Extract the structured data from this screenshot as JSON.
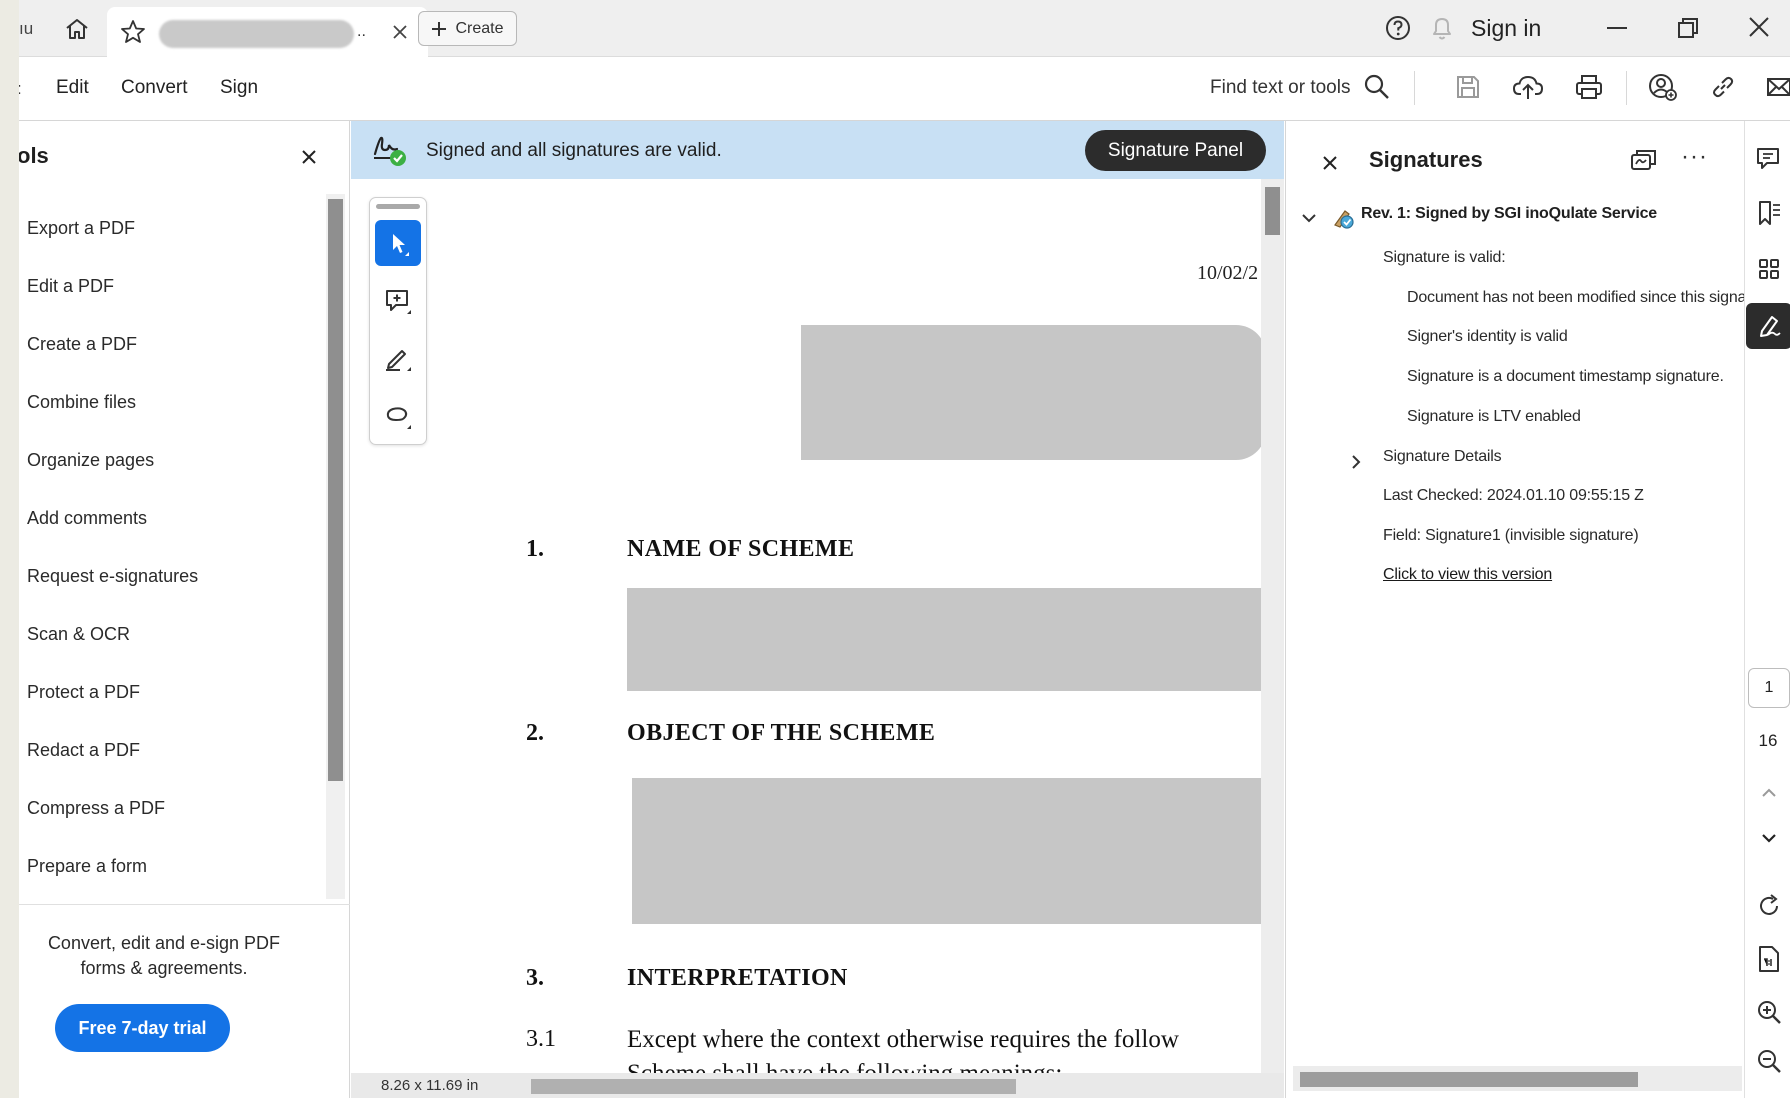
{
  "titlebar": {
    "prev_tab_label": "ıu",
    "tab_title": "████████████",
    "tab_ellipsis": "..",
    "create_label": "Create",
    "sign_in_label": "Sign in"
  },
  "menubar": {
    "cut_item": ":",
    "items": [
      {
        "label": "Edit"
      },
      {
        "label": "Convert"
      },
      {
        "label": "Sign"
      }
    ],
    "find_label": "Find text or tools"
  },
  "tools_panel": {
    "title": "ols",
    "items": [
      {
        "label": "Export a PDF"
      },
      {
        "label": "Edit a PDF"
      },
      {
        "label": "Create a PDF"
      },
      {
        "label": "Combine files"
      },
      {
        "label": "Organize pages"
      },
      {
        "label": "Add comments"
      },
      {
        "label": "Request e-signatures"
      },
      {
        "label": "Scan & OCR"
      },
      {
        "label": "Protect a PDF"
      },
      {
        "label": "Redact a PDF"
      },
      {
        "label": "Compress a PDF"
      },
      {
        "label": "Prepare a form"
      }
    ],
    "promo_line1": "Convert, edit and e-sign PDF",
    "promo_line2": "forms & agreements.",
    "trial_label": "Free 7-day trial"
  },
  "doc": {
    "banner_text": "Signed and all signatures are valid.",
    "signature_panel_label": "Signature Panel",
    "date_text": "10/02/2",
    "sections": [
      {
        "num": "1.",
        "title": "NAME OF SCHEME"
      },
      {
        "num": "2.",
        "title": "OBJECT OF THE SCHEME"
      },
      {
        "num": "3.",
        "title": "INTERPRETATION"
      }
    ],
    "subsection_num": "3.1",
    "subsection_text": "Except where the context otherwise requires the follow",
    "subsection_text2": "Scheme shall have the following meanings:",
    "page_size": "8.26 x 11.69 in"
  },
  "signatures": {
    "title": "Signatures",
    "more": "···",
    "revision_label": "Rev. 1: Signed by SGI inoQulate Service",
    "valid_heading": "Signature is valid:",
    "valid_items": [
      "Document has not been modified since this signature was applied",
      "Signer's identity is valid",
      "Signature is a document timestamp signature.",
      "Signature is LTV enabled"
    ],
    "details_label": "Signature Details",
    "last_checked": "Last Checked: 2024.01.10 09:55:15 Z",
    "field": "Field: Signature1 (invisible signature)",
    "view_version": "Click to view this version"
  },
  "rail": {
    "current_page": "1",
    "total_pages": "16"
  },
  "colors": {
    "accent": "#1473e6",
    "banner": "#c8e0f4",
    "dark_button": "#2c2c2c",
    "valid_green": "#3cb043"
  }
}
